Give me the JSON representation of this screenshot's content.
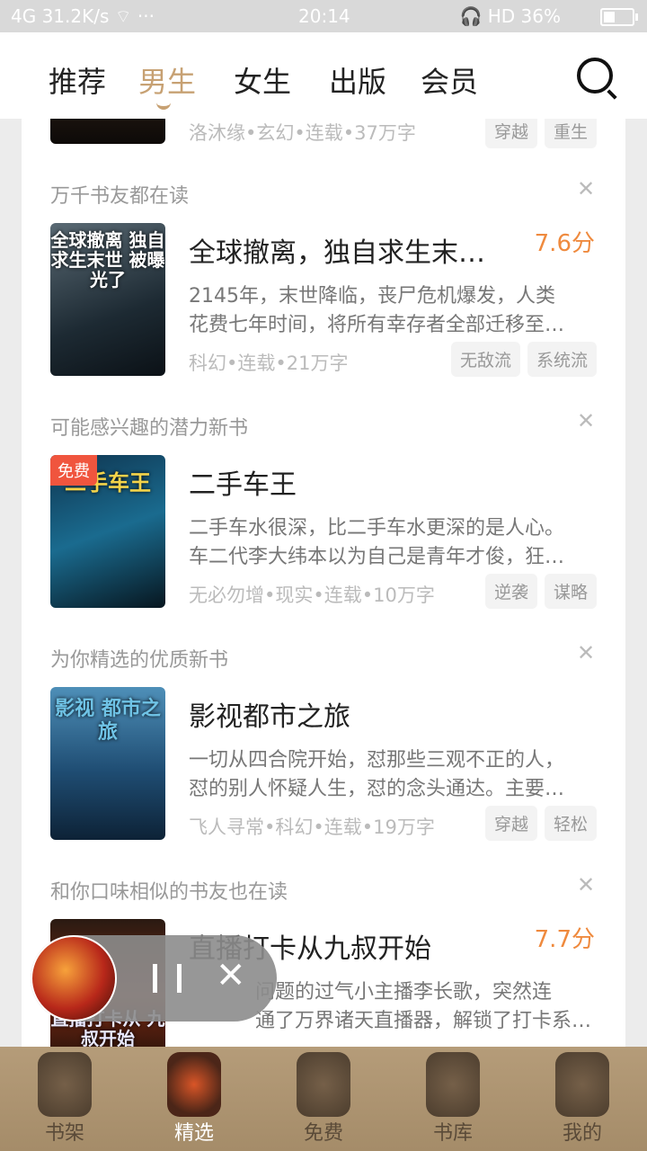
{
  "status_bar": {
    "left": "4G 31.2K/s ⌔ ···",
    "time": "20:14",
    "right": "🎧 HD 36%",
    "battery_level": 0.36
  },
  "top_tabs": [
    {
      "label": "推荐",
      "active": false
    },
    {
      "label": "男生",
      "active": true
    },
    {
      "label": "女生",
      "active": false
    },
    {
      "label": "出版",
      "active": false
    },
    {
      "label": "会员",
      "active": false
    }
  ],
  "feed": {
    "partial_top": {
      "meta": "洛沐缘•玄幻•连载•37万字",
      "tags": [
        "穿越",
        "重生"
      ]
    },
    "cards": [
      {
        "reason": "万千书友都在读",
        "cover_text": "全球撤离 独自求生末世 被曝光了",
        "title": "全球撤离，独自求生末…",
        "score": "7.6分",
        "desc": [
          "2145年，末世降临，丧尸危机爆发，人类",
          "花费七年时间，将所有幸存者全部迁移至…"
        ],
        "meta": "科幻•连载•21万字",
        "tags": [
          "无敌流",
          "系统流"
        ]
      },
      {
        "reason": "可能感兴趣的潜力新书",
        "cover_text": "二手车王",
        "badge": "免费",
        "title": "二手车王",
        "score": "",
        "desc": [
          "二手车水很深，比二手车水更深的是人心。",
          "车二代李大纬本以为自己是青年才俊，狂…"
        ],
        "meta": "无必勿增•现实•连载•10万字",
        "tags": [
          "逆袭",
          "谋略"
        ]
      },
      {
        "reason": "为你精选的优质新书",
        "cover_text": "影视 都市之旅",
        "title": "影视都市之旅",
        "score": "",
        "desc": [
          "一切从四合院开始，怼那些三观不正的人，",
          "怼的别人怀疑人生，怼的念头通达。主要…"
        ],
        "meta": "飞人寻常•科幻•连载•19万字",
        "tags": [
          "穿越",
          "轻松"
        ]
      },
      {
        "reason": "和你口味相似的书友也在读",
        "cover_text": "直播打卡从 九叔开始",
        "title": "直播打卡从九叔开始",
        "score": "7.7分",
        "desc": [
          "问题的过气小主播李长歌，突然连",
          "通了万界诸天直播器，解锁了打卡系统。…"
        ],
        "meta": "",
        "tags": []
      }
    ]
  },
  "player": {
    "close_symbol": "✕"
  },
  "bottom_nav": [
    {
      "label": "书架",
      "active": false
    },
    {
      "label": "精选",
      "active": true
    },
    {
      "label": "免费",
      "active": false
    },
    {
      "label": "书库",
      "active": false
    },
    {
      "label": "我的",
      "active": false
    }
  ]
}
